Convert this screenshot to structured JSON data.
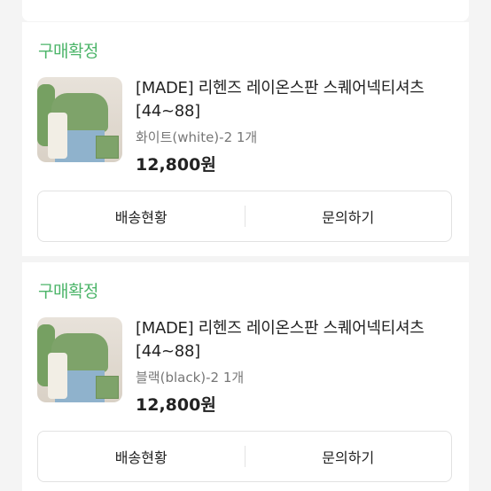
{
  "orders": [
    {
      "status": "구매확정",
      "title": "[MADE] 리헨즈 레이온스판 스퀘어넥티셔츠[44~88]",
      "option": "화이트(white)-2 1개",
      "price": "12,800원",
      "buttons": {
        "shipping": "배송현황",
        "inquiry": "문의하기"
      }
    },
    {
      "status": "구매확정",
      "title": "[MADE] 리헨즈 레이온스판 스퀘어넥티셔츠[44~88]",
      "option": "블랙(black)-2 1개",
      "price": "12,800원",
      "buttons": {
        "shipping": "배송현황",
        "inquiry": "문의하기"
      }
    }
  ],
  "colors": {
    "status_green": "#4db56a",
    "background": "#f4f4f4"
  }
}
